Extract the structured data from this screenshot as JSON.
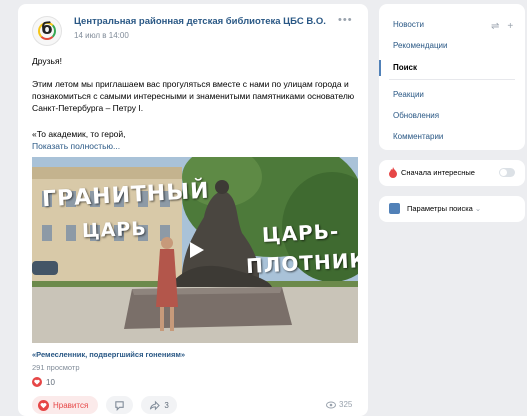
{
  "post": {
    "author": "Центральная районная детская библиотека ЦБС В.О.",
    "date": "14 июл в 14:00",
    "avatar_glyph": "б",
    "greeting": "Друзья!",
    "text": "Этим летом мы приглашаем вас прогуляться вместе с нами по улицам города и познакомиться с самыми интересными и знаменитыми памятниками основателю Санкт-Петербурга – Петру I.",
    "quote": "«То академик, то герой,",
    "show_more": "Показать полностью...",
    "video": {
      "title_line1": "ГРАНИТНЫЙ",
      "title_line2": "ЦАРЬ",
      "title_line3": "ЦАРЬ-",
      "title_line4": "ПЛОТНИК",
      "caption": "«Ремесленник, подвергшийся гонениям»",
      "views": "291 просмотр"
    },
    "reactions_count": "10",
    "like_label": "Нравится",
    "share_count": "3",
    "views_count": "325"
  },
  "menu": {
    "items": [
      {
        "label": "Новости"
      },
      {
        "label": "Рекомендации"
      },
      {
        "label": "Поиск"
      },
      {
        "label": "Реакции"
      },
      {
        "label": "Обновления"
      },
      {
        "label": "Комментарии"
      }
    ],
    "filter_label": "Сначала интересные",
    "params_label": "Параметры поиска"
  },
  "colors": {
    "link": "#2a5885",
    "accent": "#5181b8",
    "like": "#e64646"
  }
}
